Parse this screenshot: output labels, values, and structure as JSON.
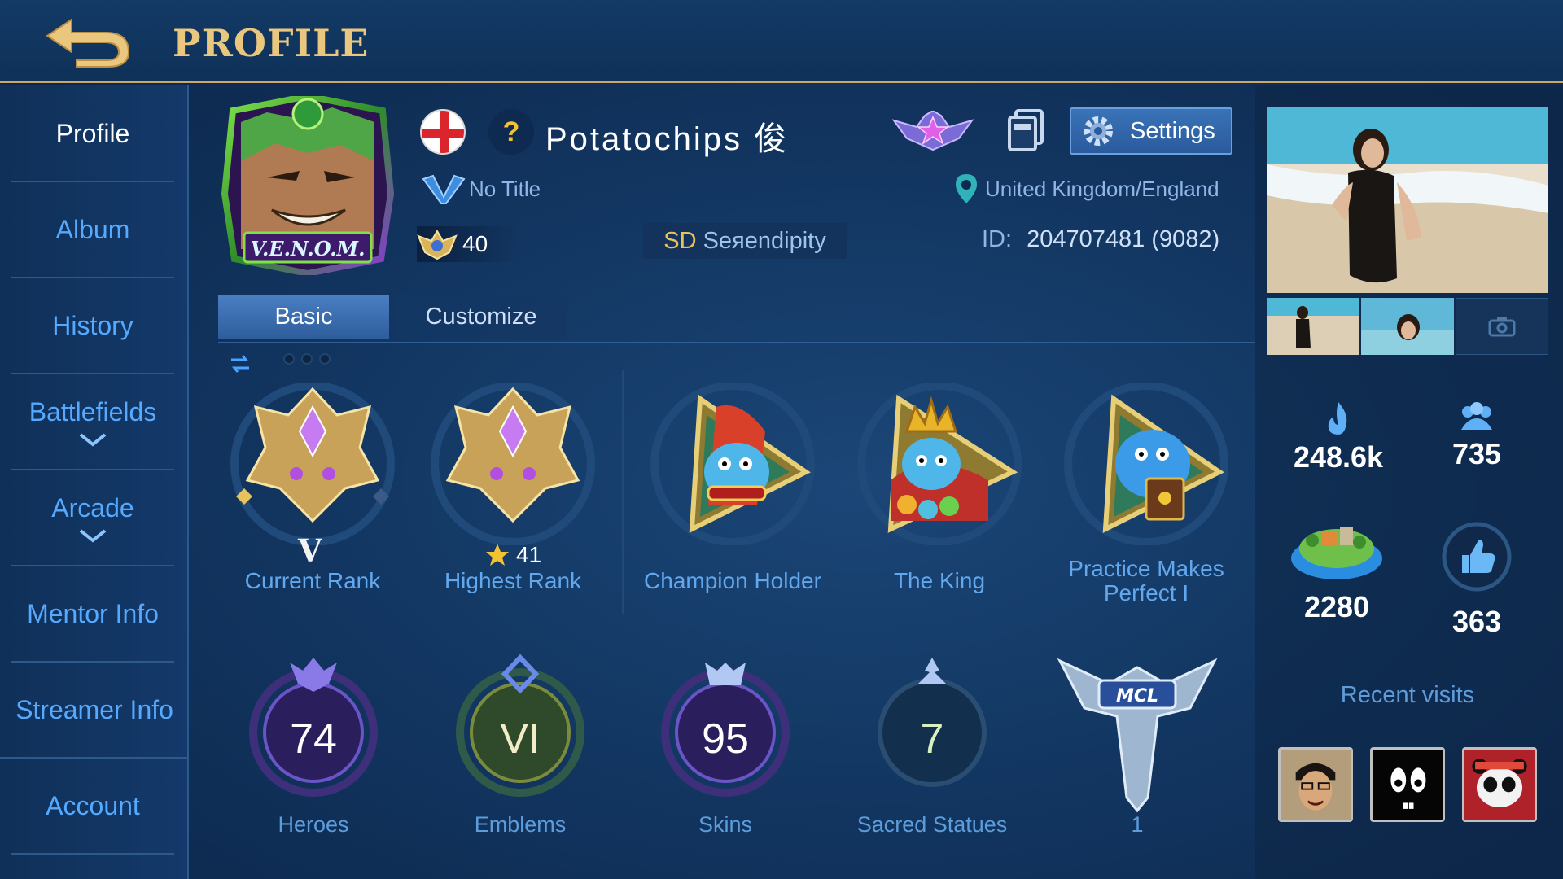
{
  "header": {
    "title": "PROFILE",
    "back_icon": "back-arrow-icon"
  },
  "sidebar": {
    "items": [
      {
        "label": "Profile",
        "active": true
      },
      {
        "label": "Album"
      },
      {
        "label": "History"
      },
      {
        "label": "Battlefields",
        "expandable": true
      },
      {
        "label": "Arcade",
        "expandable": true
      },
      {
        "label": "Mentor Info"
      },
      {
        "label": "Streamer Info"
      },
      {
        "label": "Account"
      }
    ]
  },
  "profile": {
    "avatar_text": "V.E.N.O.M.",
    "name": "Potatochips 俊",
    "flag": "england",
    "settings_label": "Settings",
    "title": "No Title",
    "location": "United Kingdom/England",
    "level": "40",
    "squad_tag": "SD",
    "squad_name": "Seяendipity",
    "id_label": "ID:",
    "id_value": "204707481 (9082)"
  },
  "tabs": [
    {
      "label": "Basic",
      "active": true
    },
    {
      "label": "Customize"
    }
  ],
  "achievements": [
    {
      "caption": "Current Rank",
      "rank": "V"
    },
    {
      "caption": "Highest Rank",
      "stars": "41"
    },
    {
      "caption": "Champion Holder"
    },
    {
      "caption": "The King"
    },
    {
      "caption": "Practice Makes Perfect I"
    }
  ],
  "stats": [
    {
      "label": "Heroes",
      "value": "74"
    },
    {
      "label": "Emblems",
      "value": "VI"
    },
    {
      "label": "Skins",
      "value": "95"
    },
    {
      "label": "Sacred Statues",
      "value": "7"
    },
    {
      "label": "1",
      "badge_text": "MCL"
    }
  ],
  "right": {
    "popularity": "248.6k",
    "followers": "735",
    "island": "2280",
    "likes": "363",
    "recent_visits_label": "Recent visits"
  },
  "colors": {
    "accent_gold": "#e9c77e",
    "link_blue": "#55a9ff",
    "panel_bg": "#123661"
  }
}
